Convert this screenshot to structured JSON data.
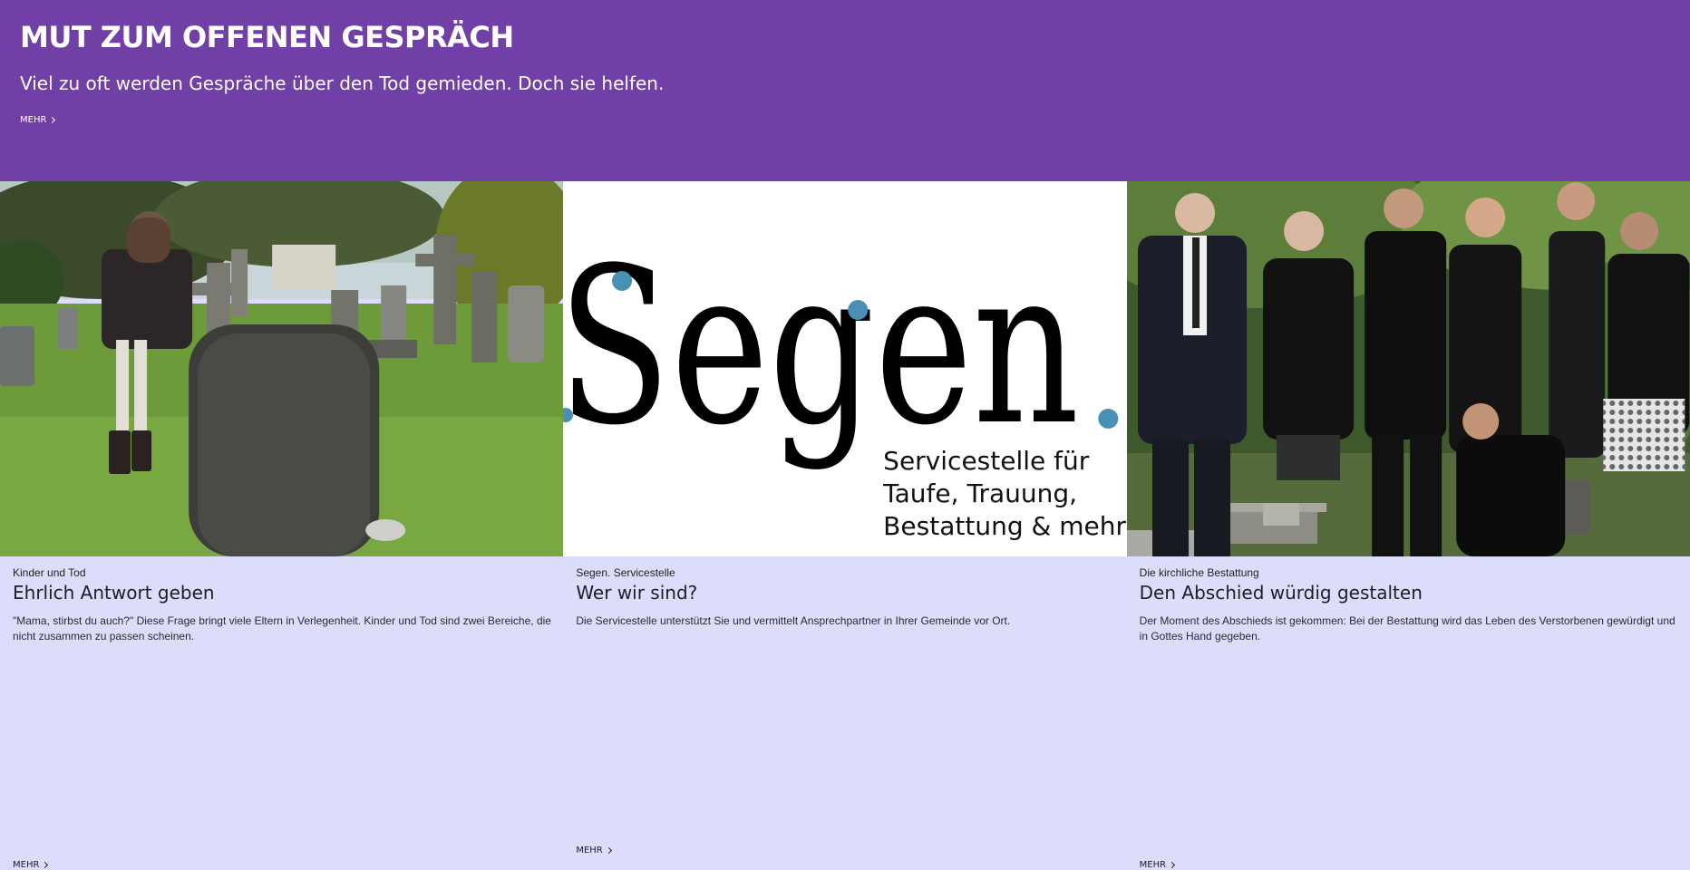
{
  "hero": {
    "title": "MUT ZUM OFFENEN GESPRÄCH",
    "subtitle": "Viel zu oft werden Gespräche über den Tod gemieden. Doch sie helfen.",
    "more_label": "MEHR",
    "bg_color": "#7140a7"
  },
  "cards": [
    {
      "category": "Kinder und Tod",
      "title": "Ehrlich Antwort geben",
      "text": "\"Mama, stirbst du auch?\" Diese Frage bringt viele Eltern in Verlegenheit. Kinder und Tod sind zwei Bereiche, die nicht zusammen zu passen scheinen.",
      "more_label": "MEHR"
    },
    {
      "category": "Segen. Servicestelle",
      "title": "Wer wir sind?",
      "text": "Die Servicestelle unterstützt Sie und vermittelt Ansprechpartner in Ihrer Gemeinde vor Ort.",
      "more_label": "MEHR",
      "logo": {
        "word": "Segen",
        "tagline_1": "Servicestelle für",
        "tagline_2": "Taufe, Trauung,",
        "tagline_3": "Bestattung & mehr",
        "dot_color": "#4a90b5"
      }
    },
    {
      "category": "Die kirchliche Bestattung",
      "title": "Den Abschied würdig gestalten",
      "text": "Der Moment des Abschieds ist gekommen: Bei der Bestattung wird das Leben des Verstorbenen gewürdigt und in Gottes Hand gegeben.",
      "more_label": "MEHR"
    }
  ],
  "card_bg_color": "#dcdcfb"
}
